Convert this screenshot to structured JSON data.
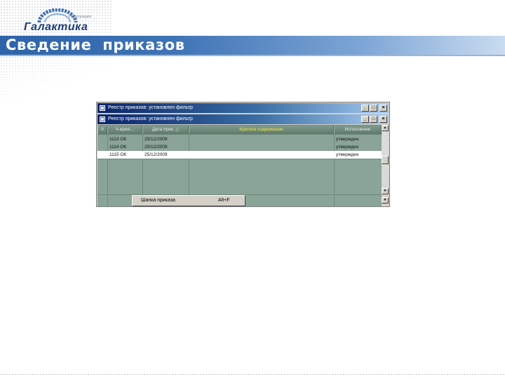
{
  "slide": {
    "title": "Сведение  приказов",
    "logo": {
      "name": "Галактика",
      "corp": "корпорация"
    }
  },
  "window": {
    "outer_title": "Реестр приказов: установлен фильтр",
    "inner_title": "Реестр приказов: установлен фильтр",
    "buttons": {
      "minimize": "_",
      "maximize": "□",
      "close": "×"
    },
    "table": {
      "columns": [
        "V",
        "Ч-ерия…",
        "Дата прик. △",
        "Краткое содержание",
        "Исполнение"
      ],
      "rows": [
        {
          "num": "1113 ОК",
          "date": "25/12/2009",
          "summary": "",
          "status": "утвержден"
        },
        {
          "num": "1114 ОК",
          "date": "25/12/2009",
          "summary": "",
          "status": "утвержден"
        },
        {
          "num": "1115 ОК",
          "date": "25/12/2009",
          "summary": "",
          "status": "утвержден"
        }
      ],
      "selected_row": 2
    },
    "popup": {
      "label": "Шапка приказа",
      "shortcut": "Alt+F"
    },
    "scroll": {
      "up": "▲",
      "down": "▼"
    }
  }
}
